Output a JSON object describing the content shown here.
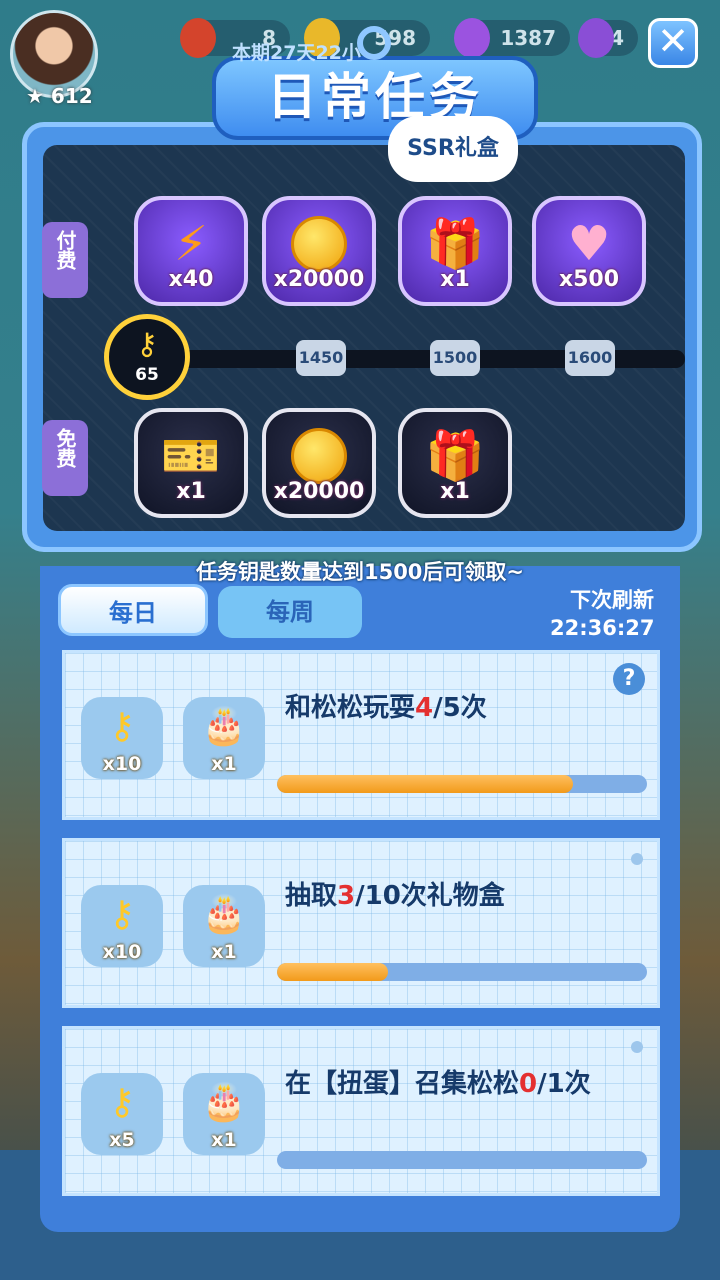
{
  "hud": {
    "avatar_stars": "612",
    "energy": "8",
    "coins": "598",
    "gems": "1387",
    "crown": "4"
  },
  "panel": {
    "title": "日常任务",
    "period": "本期27天22小",
    "ssr_bubble": "SSR礼盒",
    "paid_label": "付费",
    "free_label": "免费",
    "key_count": "65",
    "paid_rewards": [
      {
        "icon": "lightning-icon",
        "qty": "x40"
      },
      {
        "icon": "coin-icon",
        "qty": "x20000"
      },
      {
        "icon": "gift-box-icon",
        "qty": "x1"
      },
      {
        "icon": "heart-icon",
        "qty": "x500"
      }
    ],
    "free_rewards": [
      {
        "icon": "ticket-icon",
        "qty": "x1"
      },
      {
        "icon": "coin-icon",
        "qty": "x20000"
      },
      {
        "icon": "gift-box-icon",
        "qty": "x1"
      }
    ],
    "thresholds": [
      "1450",
      "1500",
      "1600"
    ],
    "hint": "任务钥匙数量达到1500后可领取~"
  },
  "tabs": {
    "daily": "每日",
    "weekly": "每周"
  },
  "refresh": {
    "label": "下次刷新",
    "time": "22:36:27"
  },
  "tasks": [
    {
      "key_qty": "x10",
      "cake_qty": "x1",
      "pre": "和松松玩耍",
      "cur": "4",
      "post": "/5次",
      "progress": 0.8
    },
    {
      "key_qty": "x10",
      "cake_qty": "x1",
      "pre": "抽取",
      "cur": "3",
      "post": "/10次礼物盒",
      "progress": 0.3
    },
    {
      "key_qty": "x5",
      "cake_qty": "x1",
      "pre": "在【扭蛋】召集松松",
      "cur": "0",
      "post": "/1次",
      "progress": 0.0
    }
  ],
  "colors": {
    "accent": "#3f8df0",
    "highlight": "#e43030",
    "progress": "#f29a1a"
  }
}
